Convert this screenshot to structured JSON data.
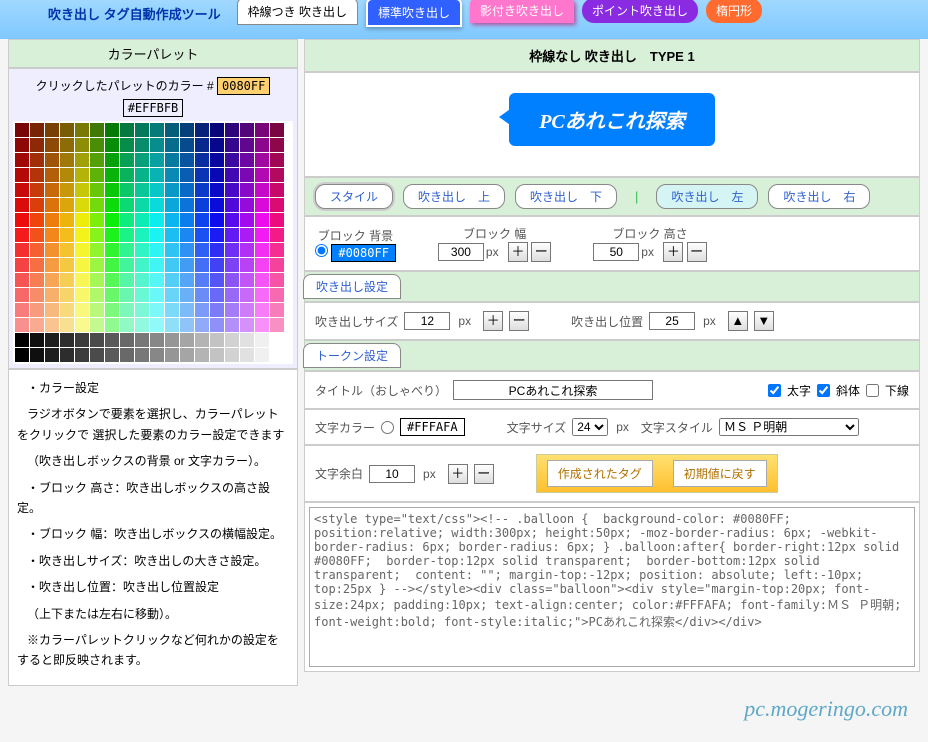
{
  "header": {
    "site_title": "吹き出し タグ自動作成ツール",
    "tabs": [
      "枠線つき 吹き出し",
      "標準吹き出し",
      "影付き吹き出し",
      "ポイント吹き出し",
      "楕円形"
    ]
  },
  "palette": {
    "title": "カラーパレット",
    "clicked_label": "クリックしたパレットのカラー #",
    "clicked_value": "0080FF",
    "sub_value": "#EFFBFB"
  },
  "help": {
    "p1": "・カラー設定",
    "p2": "ラジオボタンで要素を選択し、カラーパレットをクリックで 選択した要素のカラー設定できます",
    "p3": "（吹き出しボックスの背景 or 文字カラー）。",
    "p4": "・ブロック 高さ：吹き出しボックスの高さ設定。",
    "p5": "・ブロック 幅：吹き出しボックスの横幅設定。",
    "p6": "・吹き出しサイズ：吹き出しの大きさ設定。",
    "p7": "・吹き出し位置：吹き出し位置設定",
    "p8": "（上下または左右に移動）。",
    "p9": "※カラーパレットクリックなど何れかの設定をすると即反映されます。"
  },
  "main": {
    "title": "枠線なし 吹き出し　TYPE 1",
    "preview_text": "PCあれこれ探索"
  },
  "style_row": {
    "style": "スタイル",
    "top": "吹き出し　上",
    "bottom": "吹き出し　下",
    "left": "吹き出し　左",
    "right": "吹き出し　右"
  },
  "block": {
    "bg_label": "ブロック 背景",
    "bg_value": "#0080FF",
    "width_label": "ブロック 幅",
    "width_value": "300",
    "height_label": "ブロック 高さ",
    "height_value": "50"
  },
  "balloon_settings": {
    "tab": "吹き出し設定",
    "size_label": "吹き出しサイズ",
    "size_value": "12",
    "pos_label": "吹き出し位置",
    "pos_value": "25"
  },
  "token": {
    "tab": "トークン設定",
    "title_label": "タイトル（おしゃべり）",
    "title_value": "PCあれこれ探索",
    "bold": "太字",
    "italic": "斜体",
    "underline": "下線",
    "color_label": "文字カラー",
    "color_value": "#FFFAFA",
    "size_label": "文字サイズ",
    "size_value": "24",
    "style_label": "文字スタイル",
    "style_value": "ＭＳ Ｐ明朝",
    "margin_label": "文字余白",
    "margin_value": "10",
    "gen_btn": "作成されたタグ",
    "reset_btn": "初期値に戻す"
  },
  "output": "<style type=\"text/css\"><!-- .balloon {  background-color: #0080FF; position:relative; width:300px; height:50px; -moz-border-radius: 6px; -webkit-border-radius: 6px; border-radius: 6px; } .balloon:after{ border-right:12px solid #0080FF;  border-top:12px solid transparent;  border-bottom:12px solid transparent;  content: \"\"; margin-top:-12px; position: absolute; left:-10px; top:25px } --></style><div class=\"balloon\"><div style=\"margin-top:20px; font-size:24px; padding:10px; text-align:center; color:#FFFAFA; font-family:ＭＳ Ｐ明朝; font-weight:bold; font-style:italic;\">PCあれこれ探索</div></div>",
  "watermark": "pc.mogeringo.com",
  "px": "px",
  "plus": "＋",
  "minus": "ー",
  "up": "▲",
  "down": "▼"
}
